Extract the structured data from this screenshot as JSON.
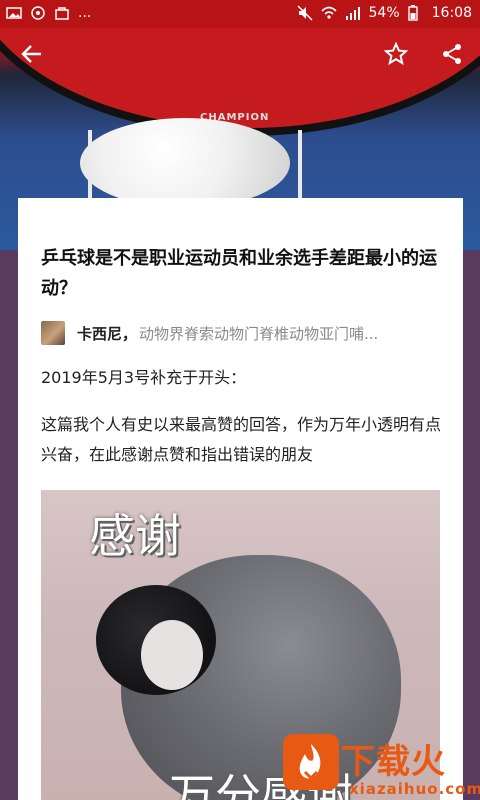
{
  "statusbar": {
    "left_more": "...",
    "battery_pct": "54%",
    "time": "16:08"
  },
  "hero": {
    "brand": "CHAMPION"
  },
  "article": {
    "title": "乒乓球是不是职业运动员和业余选手差距最小的运动？",
    "author_name": "卡西尼，",
    "author_bio": "动物界脊索动物门脊椎动物亚门哺...",
    "para1": "2019年5月3号补充于开头：",
    "para2": "这篇我个人有史以来最高赞的回答，作为万年小透明有点兴奋，在此感谢点赞和指出错误的朋友",
    "image_caption_top": "感谢",
    "image_caption_bottom": "万分感谢"
  },
  "watermark": {
    "logo_text": "下载火",
    "url": "xiazaihuo.com"
  },
  "icons": {
    "back": "back-arrow-icon",
    "star": "star-icon",
    "share": "share-icon"
  },
  "colors": {
    "statusbar": "#b81415",
    "background": "#5b3a60",
    "watermark": "#e85a14"
  }
}
